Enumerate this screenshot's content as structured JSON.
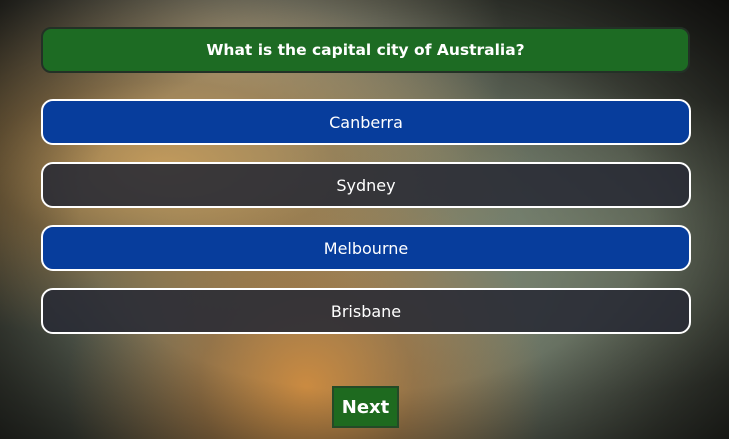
{
  "question": {
    "text": "What is the capital city of Australia?"
  },
  "answers": [
    {
      "label": "Canberra",
      "style": "blue"
    },
    {
      "label": "Sydney",
      "style": "dark"
    },
    {
      "label": "Melbourne",
      "style": "blue"
    },
    {
      "label": "Brisbane",
      "style": "dark"
    }
  ],
  "next_button": {
    "label": "Next"
  },
  "colors": {
    "question_bg": "#1d6b23",
    "answer_blue": "#073d9c",
    "answer_dark": "#282a34",
    "next_bg": "#1e6a1f",
    "text": "#ffffff"
  }
}
